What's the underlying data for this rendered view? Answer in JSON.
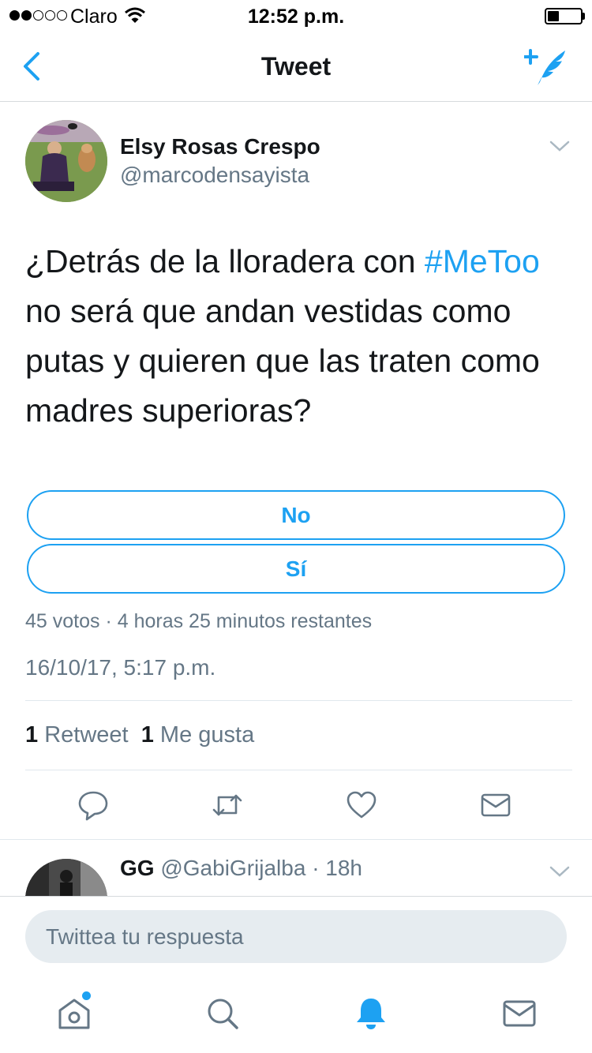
{
  "status_bar": {
    "carrier": "Claro",
    "time": "12:52 p.m.",
    "signal_bars_filled": 2,
    "signal_bars_total": 5,
    "battery_level": 0.25
  },
  "nav": {
    "title": "Tweet",
    "back_icon": "chevron-left-icon",
    "compose_icon": "compose-tweet-icon"
  },
  "tweet": {
    "author_name": "Elsy Rosas Crespo",
    "author_handle": "@marcodensayista",
    "text_before": "¿Detrás de la lloradera con ",
    "hashtag": "#MeToo",
    "text_after": " no será que andan vestidas como putas y quieren que las traten como madres superioras?",
    "poll": {
      "options": [
        "No",
        "Sí"
      ],
      "meta": "45 votos · 4 horas 25 minutos restantes"
    },
    "timestamp": "16/10/17, 5:17 p.m.",
    "stats": {
      "retweets_count": "1",
      "retweets_label": "Retweet",
      "likes_count": "1",
      "likes_label": "Me gusta"
    },
    "actions": [
      "reply-icon",
      "retweet-icon",
      "like-icon",
      "share-dm-icon"
    ]
  },
  "reply_preview": {
    "name": "GG",
    "handle": "@GabiGrijalba",
    "time": "· 18h"
  },
  "composer": {
    "placeholder": "Twittea tu respuesta"
  },
  "tab_bar": {
    "tabs": [
      "home-icon",
      "search-icon",
      "notifications-icon",
      "messages-icon"
    ],
    "active": "notifications-icon"
  },
  "colors": {
    "accent": "#1da1f2",
    "secondary_text": "#657786",
    "primary_text": "#14171a",
    "input_bg": "#e6ecf0"
  }
}
